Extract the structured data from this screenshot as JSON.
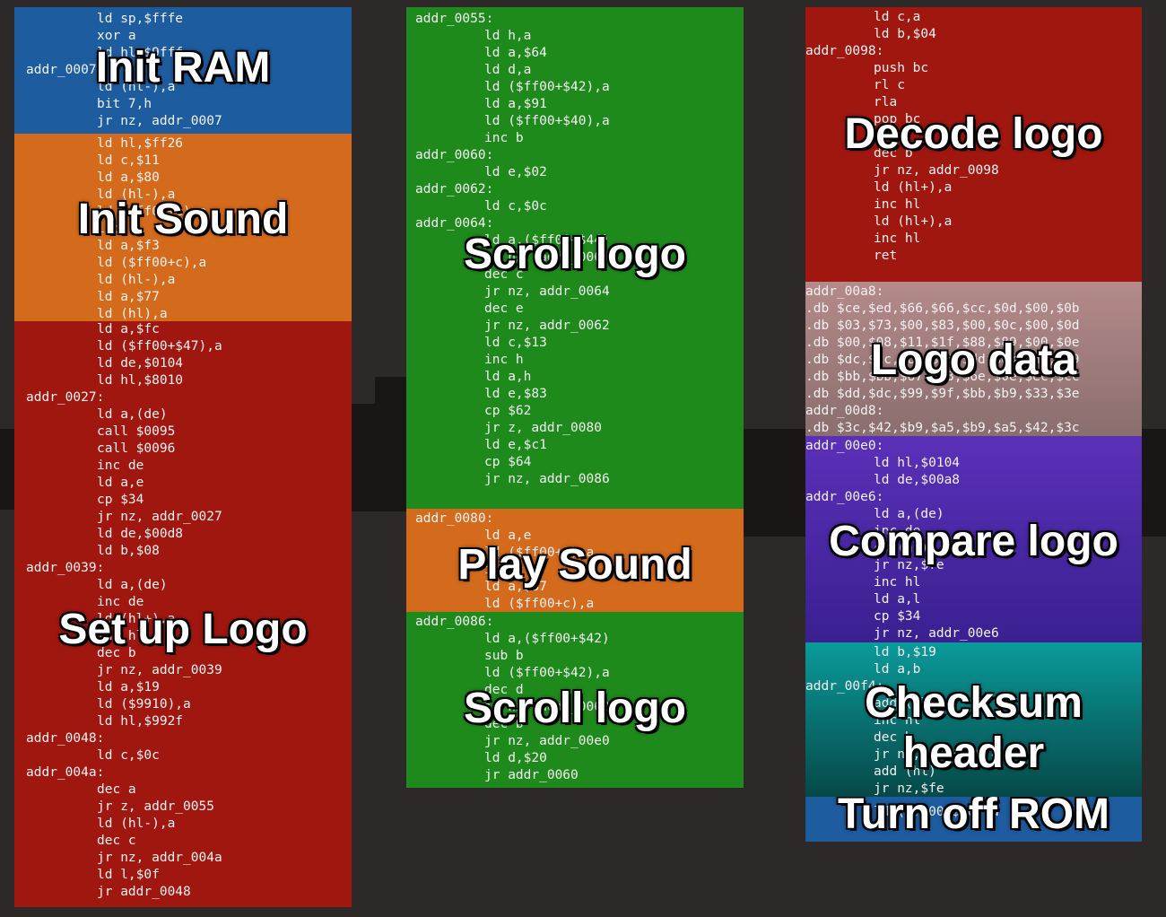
{
  "columns": [
    {
      "id": "col1",
      "sections": [
        {
          "name": "init-ram",
          "label": "Init RAM",
          "color": "#1d5c9e",
          "lines": [
            {
              "t": "i",
              "text": "ld sp,$fffe"
            },
            {
              "t": "i",
              "text": "xor a"
            },
            {
              "t": "i",
              "text": "ld hl,$9fff"
            },
            {
              "t": "l",
              "text": "addr_0007:"
            },
            {
              "t": "i",
              "text": "ld (hl-),a"
            },
            {
              "t": "i",
              "text": "bit 7,h"
            },
            {
              "t": "i",
              "text": "jr nz, addr_0007"
            }
          ]
        },
        {
          "name": "init-sound",
          "label": "Init Sound",
          "color": "#d46a1c",
          "lines": [
            {
              "t": "i",
              "text": "ld hl,$ff26"
            },
            {
              "t": "i",
              "text": "ld c,$11"
            },
            {
              "t": "i",
              "text": "ld a,$80"
            },
            {
              "t": "i",
              "text": "ld (hl-),a"
            },
            {
              "t": "i",
              "text": "ld ($ff00+c),a"
            },
            {
              "t": "i",
              "text": "inc c"
            },
            {
              "t": "i",
              "text": "ld a,$f3"
            },
            {
              "t": "i",
              "text": "ld ($ff00+c),a"
            },
            {
              "t": "i",
              "text": "ld (hl-),a"
            },
            {
              "t": "i",
              "text": "ld a,$77"
            },
            {
              "t": "i",
              "text": "ld (hl),a"
            }
          ]
        },
        {
          "name": "set-up-logo",
          "label": "Set up Logo",
          "color": "#a01710",
          "lines": [
            {
              "t": "i",
              "text": "ld a,$fc"
            },
            {
              "t": "i",
              "text": "ld ($ff00+$47),a"
            },
            {
              "t": "i",
              "text": "ld de,$0104"
            },
            {
              "t": "i",
              "text": "ld hl,$8010"
            },
            {
              "t": "l",
              "text": "addr_0027:"
            },
            {
              "t": "i",
              "text": "ld a,(de)"
            },
            {
              "t": "i",
              "text": "call $0095"
            },
            {
              "t": "i",
              "text": "call $0096"
            },
            {
              "t": "i",
              "text": "inc de"
            },
            {
              "t": "i",
              "text": "ld a,e"
            },
            {
              "t": "i",
              "text": "cp $34"
            },
            {
              "t": "i",
              "text": "jr nz, addr_0027"
            },
            {
              "t": "i",
              "text": "ld de,$00d8"
            },
            {
              "t": "i",
              "text": "ld b,$08"
            },
            {
              "t": "l",
              "text": "addr_0039:"
            },
            {
              "t": "i",
              "text": "ld a,(de)"
            },
            {
              "t": "i",
              "text": "inc de"
            },
            {
              "t": "i",
              "text": "ld (hl+),a"
            },
            {
              "t": "i",
              "text": "inc hl"
            },
            {
              "t": "i",
              "text": "dec b"
            },
            {
              "t": "i",
              "text": "jr nz, addr_0039"
            },
            {
              "t": "i",
              "text": "ld a,$19"
            },
            {
              "t": "i",
              "text": "ld ($9910),a"
            },
            {
              "t": "i",
              "text": "ld hl,$992f"
            },
            {
              "t": "l",
              "text": "addr_0048:"
            },
            {
              "t": "i",
              "text": "ld c,$0c"
            },
            {
              "t": "l",
              "text": "addr_004a:"
            },
            {
              "t": "i",
              "text": "dec a"
            },
            {
              "t": "i",
              "text": "jr z, addr_0055"
            },
            {
              "t": "i",
              "text": "ld (hl-),a"
            },
            {
              "t": "i",
              "text": "dec c"
            },
            {
              "t": "i",
              "text": "jr nz, addr_004a"
            },
            {
              "t": "i",
              "text": "ld l,$0f"
            },
            {
              "t": "i",
              "text": "jr addr_0048"
            }
          ]
        }
      ]
    },
    {
      "id": "col2",
      "sections": [
        {
          "name": "scroll-logo-1",
          "label": "Scroll logo",
          "color": "#1f8a1c",
          "lines": [
            {
              "t": "l",
              "text": "addr_0055:"
            },
            {
              "t": "i",
              "text": "ld h,a"
            },
            {
              "t": "i",
              "text": "ld a,$64"
            },
            {
              "t": "i",
              "text": "ld d,a"
            },
            {
              "t": "i",
              "text": "ld ($ff00+$42),a"
            },
            {
              "t": "i",
              "text": "ld a,$91"
            },
            {
              "t": "i",
              "text": "ld ($ff00+$40),a"
            },
            {
              "t": "i",
              "text": "inc b"
            },
            {
              "t": "l",
              "text": "addr_0060:"
            },
            {
              "t": "i",
              "text": "ld e,$02"
            },
            {
              "t": "l",
              "text": "addr_0062:"
            },
            {
              "t": "i",
              "text": "ld c,$0c"
            },
            {
              "t": "l",
              "text": "addr_0064:"
            },
            {
              "t": "i",
              "text": "ld a,($ff00+$44)"
            },
            {
              "t": "i",
              "text": "jr nz, addr_0064"
            },
            {
              "t": "i",
              "text": "dec c"
            },
            {
              "t": "i",
              "text": "jr nz, addr_0064"
            },
            {
              "t": "i",
              "text": "dec e"
            },
            {
              "t": "i",
              "text": "jr nz, addr_0062"
            },
            {
              "t": "i",
              "text": "ld c,$13"
            },
            {
              "t": "i",
              "text": "inc h"
            },
            {
              "t": "i",
              "text": "ld a,h"
            },
            {
              "t": "i",
              "text": "ld e,$83"
            },
            {
              "t": "i",
              "text": "cp $62"
            },
            {
              "t": "i",
              "text": "jr z, addr_0080"
            },
            {
              "t": "i",
              "text": "ld e,$c1"
            },
            {
              "t": "i",
              "text": "cp $64"
            },
            {
              "t": "i",
              "text": "jr nz, addr_0086"
            }
          ]
        },
        {
          "name": "play-sound",
          "label": "Play Sound",
          "color": "#d46a1c",
          "lines": [
            {
              "t": "l",
              "text": "addr_0080:"
            },
            {
              "t": "i",
              "text": "ld a,e"
            },
            {
              "t": "i",
              "text": "ld ($ff00+c),a"
            },
            {
              "t": "i",
              "text": "inc c"
            },
            {
              "t": "i",
              "text": "ld a,$87"
            },
            {
              "t": "i",
              "text": "ld ($ff00+c),a"
            }
          ]
        },
        {
          "name": "scroll-logo-2",
          "label": "Scroll logo",
          "color": "#1f8a1c",
          "lines": [
            {
              "t": "l",
              "text": "addr_0086:"
            },
            {
              "t": "i",
              "text": "ld a,($ff00+$42)"
            },
            {
              "t": "i",
              "text": "sub b"
            },
            {
              "t": "i",
              "text": "ld ($ff00+$42),a"
            },
            {
              "t": "i",
              "text": "dec d"
            },
            {
              "t": "i",
              "text": "jr nz, addr_0060"
            },
            {
              "t": "i",
              "text": "dec b"
            },
            {
              "t": "i",
              "text": "jr nz, addr_00e0"
            },
            {
              "t": "i",
              "text": "ld d,$20"
            },
            {
              "t": "i",
              "text": "jr addr_0060"
            }
          ]
        }
      ]
    },
    {
      "id": "col3",
      "sections": [
        {
          "name": "decode-logo",
          "label": "Decode logo",
          "color": "#a01710",
          "lines": [
            {
              "t": "i",
              "text": "ld c,a"
            },
            {
              "t": "i",
              "text": "ld b,$04"
            },
            {
              "t": "l",
              "text": "addr_0098:"
            },
            {
              "t": "i",
              "text": "push bc"
            },
            {
              "t": "i",
              "text": "rl c"
            },
            {
              "t": "i",
              "text": "rla"
            },
            {
              "t": "i",
              "text": "pop bc"
            },
            {
              "t": "i",
              "text": "rla"
            },
            {
              "t": "i",
              "text": "dec b"
            },
            {
              "t": "i",
              "text": "jr nz, addr_0098"
            },
            {
              "t": "i",
              "text": "ld (hl+),a"
            },
            {
              "t": "i",
              "text": "inc hl"
            },
            {
              "t": "i",
              "text": "ld (hl+),a"
            },
            {
              "t": "i",
              "text": "inc hl"
            },
            {
              "t": "i",
              "text": "ret"
            }
          ]
        },
        {
          "name": "logo-data",
          "label": "Logo data",
          "color": "#9a7a7a",
          "lines": [
            {
              "t": "l",
              "text": "addr_00a8:"
            },
            {
              "t": "l",
              "text": ".db $ce,$ed,$66,$66,$cc,$0d,$00,$0b"
            },
            {
              "t": "l",
              "text": ".db $03,$73,$00,$83,$00,$0c,$00,$0d"
            },
            {
              "t": "l",
              "text": ".db $00,$08,$11,$1f,$88,$89,$00,$0e"
            },
            {
              "t": "l",
              "text": ".db $dc,$cc,$6e,$e6,$dd,$dd,$d9,$99"
            },
            {
              "t": "l",
              "text": ".db $bb,$bb,$67,$63,$6e,$0e,$ec,$cc"
            },
            {
              "t": "l",
              "text": ".db $dd,$dc,$99,$9f,$bb,$b9,$33,$3e"
            },
            {
              "t": "l",
              "text": "addr_00d8:"
            },
            {
              "t": "l",
              "text": ".db $3c,$42,$b9,$a5,$b9,$a5,$42,$3c"
            }
          ]
        },
        {
          "name": "compare-logo",
          "label": "Compare logo",
          "color": "#4a2aa0",
          "lines": [
            {
              "t": "l",
              "text": "addr_00e0:"
            },
            {
              "t": "i",
              "text": "ld hl,$0104"
            },
            {
              "t": "i",
              "text": "ld de,$00a8"
            },
            {
              "t": "l",
              "text": "addr_00e6:"
            },
            {
              "t": "i",
              "text": "ld a,(de)"
            },
            {
              "t": "i",
              "text": "inc de"
            },
            {
              "t": "i",
              "text": "cp (hl)"
            },
            {
              "t": "i",
              "text": "jr nz,$fe"
            },
            {
              "t": "i",
              "text": "inc hl"
            },
            {
              "t": "i",
              "text": "ld a,l"
            },
            {
              "t": "i",
              "text": "cp $34"
            },
            {
              "t": "i",
              "text": "jr nz, addr_00e6"
            }
          ]
        },
        {
          "name": "checksum-header",
          "label": "Checksum\nheader",
          "color": "#0a8a8a",
          "lines": [
            {
              "t": "i",
              "text": "ld b,$19"
            },
            {
              "t": "i",
              "text": "ld a,b"
            },
            {
              "t": "l",
              "text": "addr_00f4:"
            },
            {
              "t": "i",
              "text": "add (hl)"
            },
            {
              "t": "i",
              "text": "inc hl"
            },
            {
              "t": "i",
              "text": "dec b"
            },
            {
              "t": "i",
              "text": "jr nz, addr_00f4"
            },
            {
              "t": "i",
              "text": "add (hl)"
            },
            {
              "t": "i",
              "text": "jr nz,$fe"
            },
            {
              "t": "i",
              "text": "ld a,$01"
            }
          ]
        },
        {
          "name": "turn-off-rom",
          "label": "Turn off ROM",
          "color": "#1d5c9e",
          "lines": [
            {
              "t": "i",
              "text": "ld ($ff00+$50),a"
            }
          ]
        }
      ]
    }
  ]
}
